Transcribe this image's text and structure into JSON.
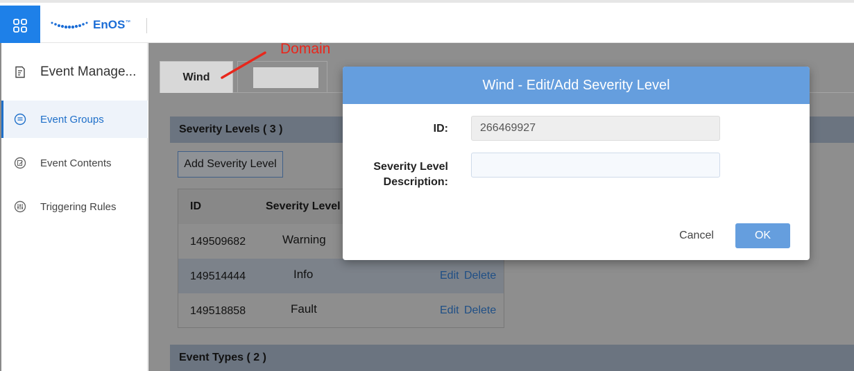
{
  "header": {
    "logo_text": "EnOS",
    "logo_tm": "™",
    "app_switch_icon": "grid-icon"
  },
  "sidebar": {
    "module_title": "Event Manage...",
    "module_icon": "document-icon",
    "items": [
      {
        "label": "Event Groups",
        "icon": "circle-list-icon",
        "active": true
      },
      {
        "label": "Event Contents",
        "icon": "circle-edit-icon",
        "active": false
      },
      {
        "label": "Triggering Rules",
        "icon": "circle-sliders-icon",
        "active": false
      }
    ]
  },
  "main": {
    "tabs": [
      {
        "label": "Wind",
        "active": true
      },
      {
        "label": ""
      }
    ],
    "severity_section": {
      "title": "Severity Levels ( 3 )",
      "add_button": "Add Severity Level",
      "columns": [
        "ID",
        "Severity Level"
      ],
      "rows": [
        {
          "id": "149509682",
          "level": "Warning",
          "edit": "",
          "delete": ""
        },
        {
          "id": "149514444",
          "level": "Info",
          "edit": "Edit",
          "delete": "Delete"
        },
        {
          "id": "149518858",
          "level": "Fault",
          "edit": "Edit",
          "delete": "Delete"
        }
      ]
    },
    "event_types_section": {
      "title": "Event Types ( 2 )"
    }
  },
  "annotation": {
    "text": "Domain",
    "color": "#e8271c"
  },
  "modal": {
    "title": "Wind - Edit/Add Severity Level",
    "id_label": "ID:",
    "id_value": "266469927",
    "desc_label_line1": "Severity Level",
    "desc_label_line2": "Description:",
    "desc_value": "",
    "cancel_label": "Cancel",
    "ok_label": "OK"
  },
  "colors": {
    "accent": "#1e80e8",
    "modal_header": "#659ede",
    "link": "#1e6fc9"
  }
}
